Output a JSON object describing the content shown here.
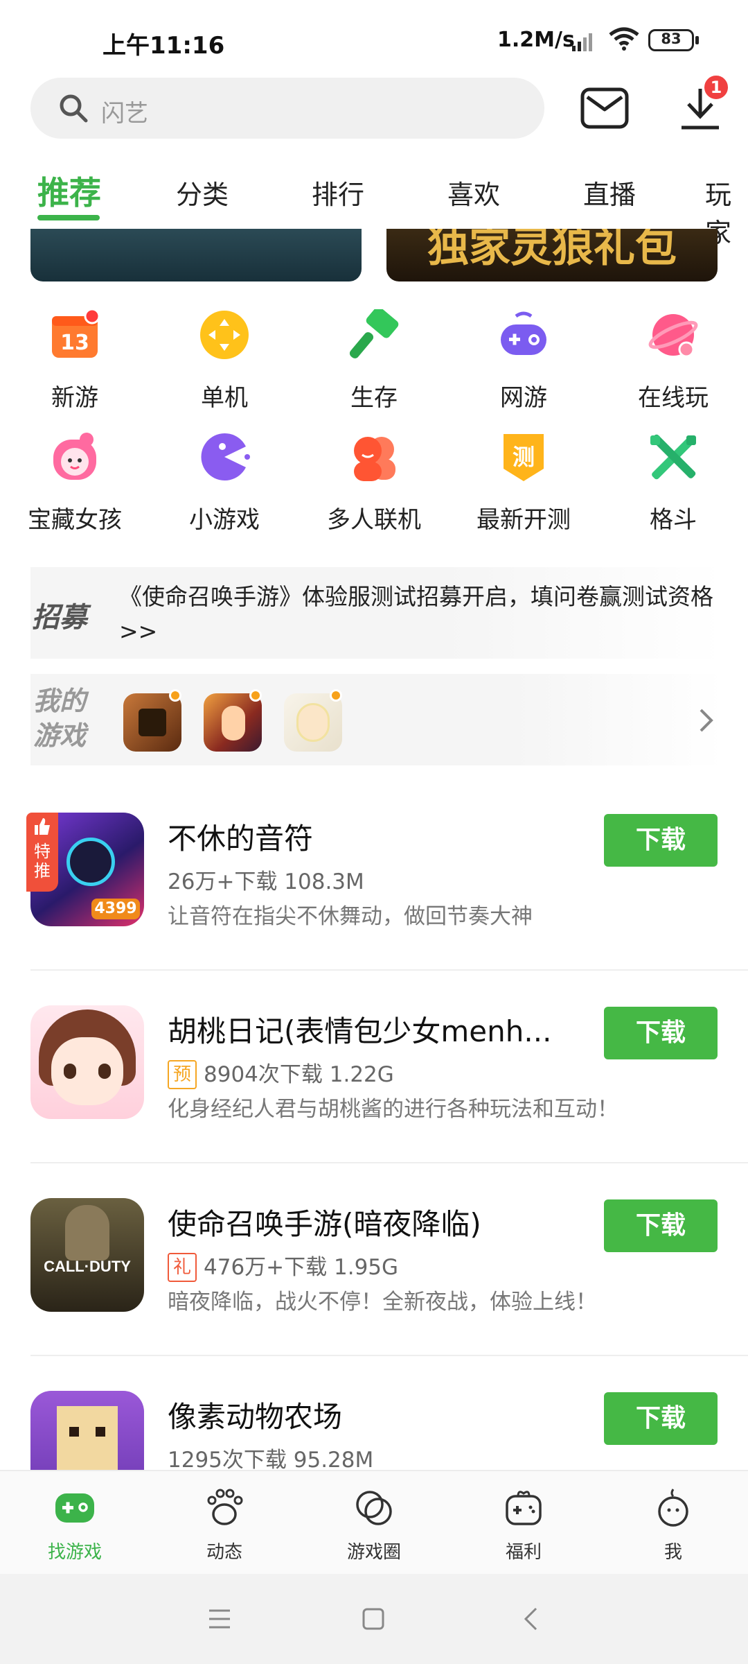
{
  "status_bar": {
    "time": "上午11:16",
    "net_speed": "1.2M/s",
    "battery": "83"
  },
  "search": {
    "placeholder": "闪艺"
  },
  "header": {
    "download_badge": "1"
  },
  "tabs": [
    {
      "label": "推荐",
      "active": true
    },
    {
      "label": "分类"
    },
    {
      "label": "排行"
    },
    {
      "label": "喜欢"
    },
    {
      "label": "直播"
    },
    {
      "label": "玩家"
    }
  ],
  "banners": [
    {
      "title": ""
    },
    {
      "title": "独家灵狼礼包"
    }
  ],
  "categories": [
    {
      "label": "新游",
      "icon": "calendar-icon",
      "color": "#ff7a2f"
    },
    {
      "label": "单机",
      "icon": "dpad-icon",
      "color": "#ffc21a"
    },
    {
      "label": "生存",
      "icon": "hammer-icon",
      "color": "#33c75a"
    },
    {
      "label": "网游",
      "icon": "gamepad-icon",
      "color": "#7b5cf0"
    },
    {
      "label": "在线玩",
      "icon": "planet-icon",
      "color": "#ff5a8a"
    },
    {
      "label": "宝藏女孩",
      "icon": "girl-icon",
      "color": "#ff6aa0"
    },
    {
      "label": "小游戏",
      "icon": "pacman-icon",
      "color": "#8a5cf0"
    },
    {
      "label": "多人联机",
      "icon": "people-icon",
      "color": "#ff5533"
    },
    {
      "label": "最新开测",
      "icon": "test-badge-icon",
      "color": "#ffb41a",
      "glyph": "测"
    },
    {
      "label": "格斗",
      "icon": "crossed-swords-icon",
      "color": "#33c77a"
    }
  ],
  "notice": {
    "tag": "招募",
    "text": "《使命召唤手游》体验服测试招募开启，填问卷赢测试资格 >>"
  },
  "my_games": {
    "tag": "我的游戏"
  },
  "games": [
    {
      "name": "不休的音符",
      "badge": "",
      "meta": "26万+下载   108.3M",
      "desc": "让音符在指尖不休舞动，做回节奏大神",
      "button": "下载",
      "corner": "特推"
    },
    {
      "name": "胡桃日记(表情包少女menh...",
      "badge": "预",
      "meta": "8904次下载   1.22G",
      "desc": "化身经纪人君与胡桃酱的进行各种玩法和互动！",
      "button": "下载"
    },
    {
      "name": "使命召唤手游(暗夜降临)",
      "badge": "礼",
      "meta": "476万+下载   1.95G",
      "desc": "暗夜降临，战火不停！全新夜战，体验上线！",
      "button": "下载",
      "icon_text": "CALL·DUTY"
    },
    {
      "name": "像素动物农场",
      "badge": "",
      "meta": "1295次下载   95.28M",
      "desc": "",
      "button": "下载"
    }
  ],
  "bottom_nav": [
    {
      "label": "找游戏",
      "icon": "gamepad-icon",
      "active": true
    },
    {
      "label": "动态",
      "icon": "footprint-icon"
    },
    {
      "label": "游戏圈",
      "icon": "circles-icon"
    },
    {
      "label": "福利",
      "icon": "gift-gamepad-icon"
    },
    {
      "label": "我",
      "icon": "person-icon"
    }
  ],
  "colors": {
    "brand_green": "#3cb34a",
    "download_green": "#45b845"
  }
}
